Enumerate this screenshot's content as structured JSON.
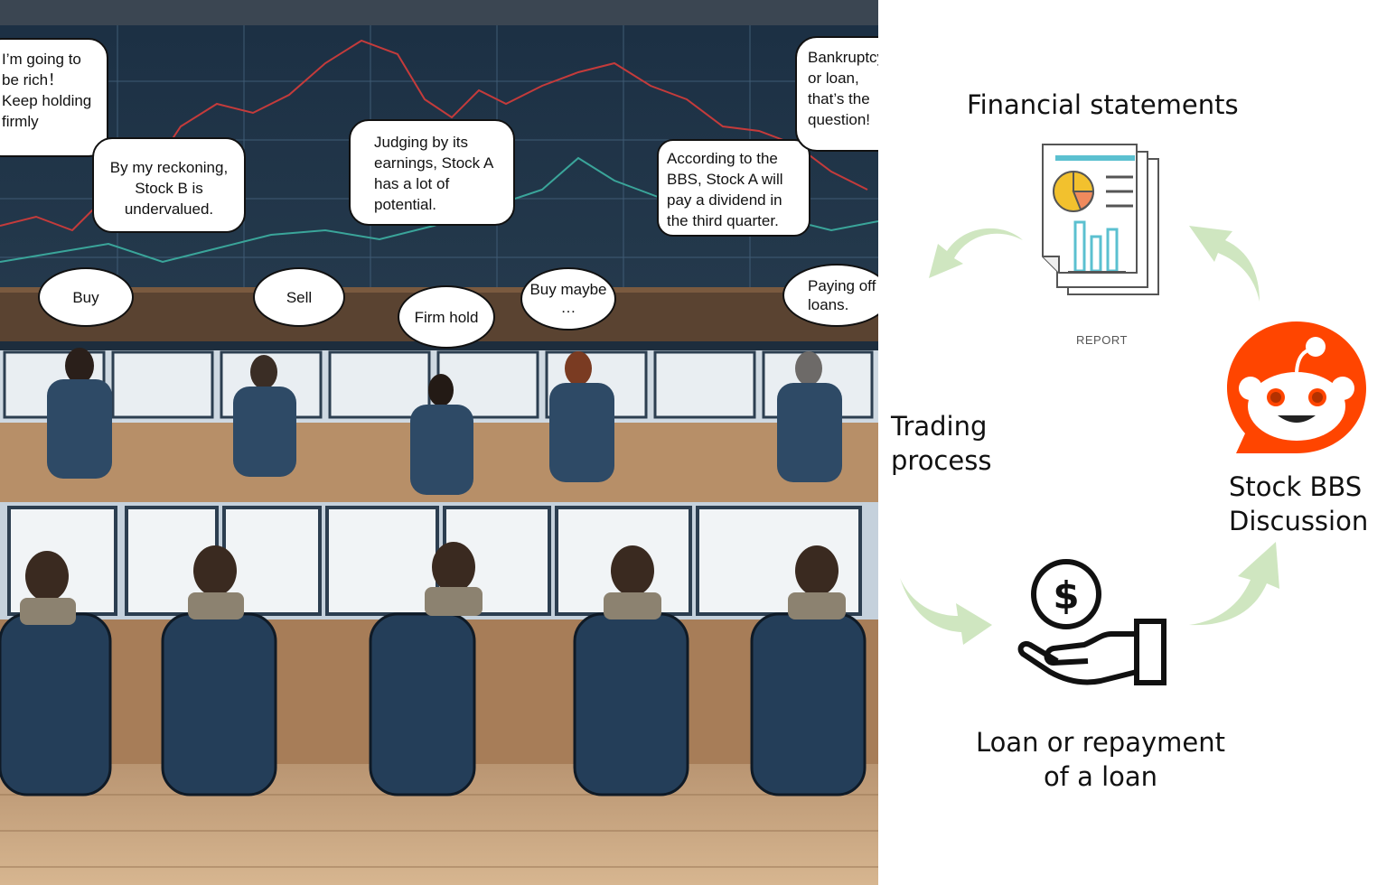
{
  "scene": {
    "bubbles": [
      {
        "id": "rich",
        "text": "I’m going to be rich！Keep holding firmly"
      },
      {
        "id": "stock-b",
        "text": "By my reckoning, Stock B is undervalued."
      },
      {
        "id": "earnings",
        "text": "Judging by its earnings, Stock A has a lot of potential."
      },
      {
        "id": "dividend",
        "text": "According to the BBS, Stock A will pay a dividend in the third quarter."
      },
      {
        "id": "bankrupt",
        "text": "Bankruptcy or loan, that’s the question!"
      },
      {
        "id": "buy",
        "text": "Buy"
      },
      {
        "id": "sell",
        "text": "Sell"
      },
      {
        "id": "firm-hold",
        "text": "Firm hold"
      },
      {
        "id": "buy-maybe",
        "text": "Buy maybe …"
      },
      {
        "id": "paying-off",
        "text": "Paying off loans."
      }
    ]
  },
  "diagram": {
    "financial_statements": "Financial statements",
    "report_caption": "REPORT",
    "trading_process": "Trading process",
    "stock_bbs": "Stock BBS Discussion",
    "loan": "Loan or repayment of a loan",
    "colors": {
      "arrow": "#cfe6c0",
      "reddit": "#ff4500",
      "report_accent": "#5bc0d0",
      "pie": "#f2c12e"
    }
  }
}
